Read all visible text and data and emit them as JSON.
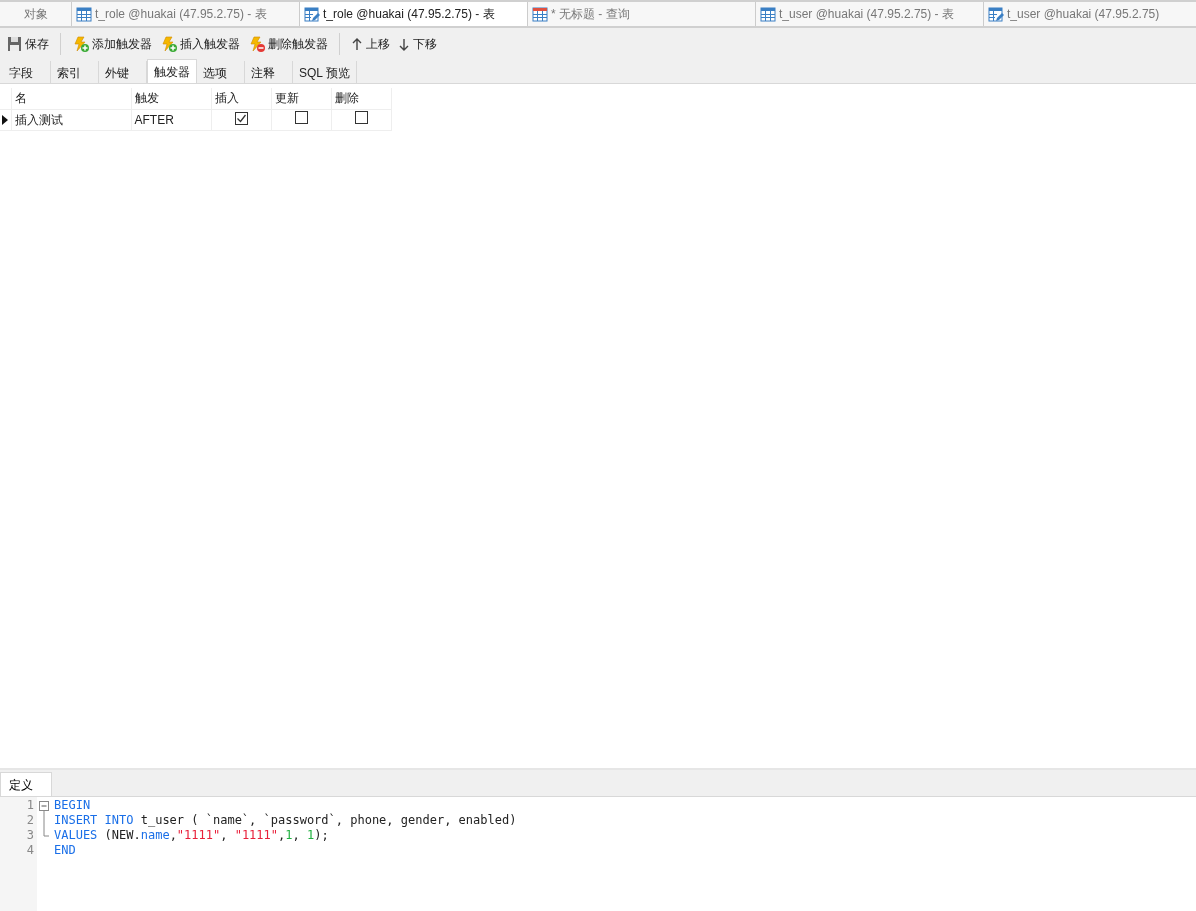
{
  "document_tabs": [
    {
      "label": "对象",
      "kind": "objects",
      "selected": false
    },
    {
      "label": "t_role @huakai (47.95.2.75) - 表",
      "kind": "table",
      "selected": false
    },
    {
      "label": "t_role @huakai (47.95.2.75) - 表",
      "kind": "design",
      "selected": true
    },
    {
      "label": "* 无标题 - 查询",
      "kind": "query",
      "selected": false
    },
    {
      "label": "t_user @huakai (47.95.2.75) - 表",
      "kind": "table",
      "selected": false
    },
    {
      "label": "t_user @huakai (47.95.2.75)",
      "kind": "design",
      "selected": false
    }
  ],
  "toolbar": [
    [
      {
        "label": "保存",
        "kind": "save"
      }
    ],
    [
      {
        "label": "添加触发器",
        "kind": "add"
      },
      {
        "label": "插入触发器",
        "kind": "add"
      },
      {
        "label": "删除触发器",
        "kind": "delete"
      }
    ],
    [
      {
        "label": "上移",
        "kind": "up"
      },
      {
        "label": "下移",
        "kind": "down"
      }
    ]
  ],
  "designer_tabs": [
    {
      "label": "字段",
      "selected": false
    },
    {
      "label": "索引",
      "selected": false
    },
    {
      "label": "外键",
      "selected": false
    },
    {
      "label": "触发器",
      "selected": true
    },
    {
      "label": "选项",
      "selected": false
    },
    {
      "label": "注释",
      "selected": false
    },
    {
      "label": "SQL 预览",
      "selected": false
    }
  ],
  "trigger_table": {
    "columns": [
      "名",
      "触发",
      "插入",
      "更新",
      "删除"
    ],
    "rows": [
      {
        "current": true,
        "name": "插入测试",
        "timing": "AFTER",
        "insert": true,
        "update": false,
        "delete": false
      }
    ]
  },
  "definition_panel": {
    "tab": {
      "label": "定义",
      "selected": true
    },
    "lines": [
      {
        "number": "1",
        "tokens": [
          {
            "kind": "keyword",
            "text": "BEGIN"
          }
        ]
      },
      {
        "number": "2",
        "tokens": [
          {
            "kind": "keyword",
            "text": "INSERT INTO"
          },
          {
            "kind": "plain",
            "text": " t_user ( `name`, `password`, phone, gender, enabled)"
          }
        ]
      },
      {
        "number": "3",
        "tokens": [
          {
            "kind": "keyword",
            "text": "VALUES"
          },
          {
            "kind": "plain",
            "text": " (NEW."
          },
          {
            "kind": "keyword",
            "text": "name"
          },
          {
            "kind": "plain",
            "text": ","
          },
          {
            "kind": "string",
            "text": "\"1111\""
          },
          {
            "kind": "plain",
            "text": ", "
          },
          {
            "kind": "string",
            "text": "\"1111\""
          },
          {
            "kind": "plain",
            "text": ","
          },
          {
            "kind": "number",
            "text": "1"
          },
          {
            "kind": "plain",
            "text": ", "
          },
          {
            "kind": "number",
            "text": "1"
          },
          {
            "kind": "plain",
            "text": ");"
          }
        ]
      },
      {
        "number": "4",
        "tokens": [
          {
            "kind": "keyword",
            "text": "END"
          }
        ]
      }
    ]
  }
}
